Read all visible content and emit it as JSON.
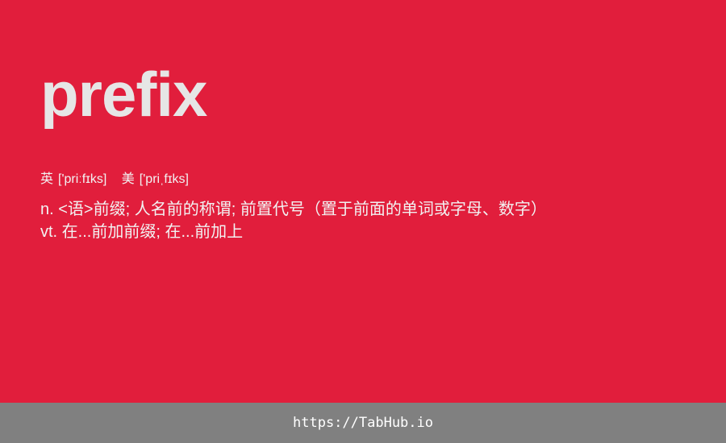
{
  "card": {
    "word": "prefix",
    "phonetics": [
      {
        "lang": "英",
        "ipa": "['priːfɪks]"
      },
      {
        "lang": "美",
        "ipa": "['priˌfɪks]"
      }
    ],
    "definitions": [
      "n. <语>前缀; 人名前的称谓; 前置代号（置于前面的单词或字母、数字）",
      "vt. 在...前加前缀; 在...前加上"
    ]
  },
  "footer": {
    "url": "https://TabHub.io"
  },
  "colors": {
    "background": "#e11e3c",
    "footer": "#808080",
    "word": "#e6e6e6",
    "text": "#f2f2f2"
  }
}
